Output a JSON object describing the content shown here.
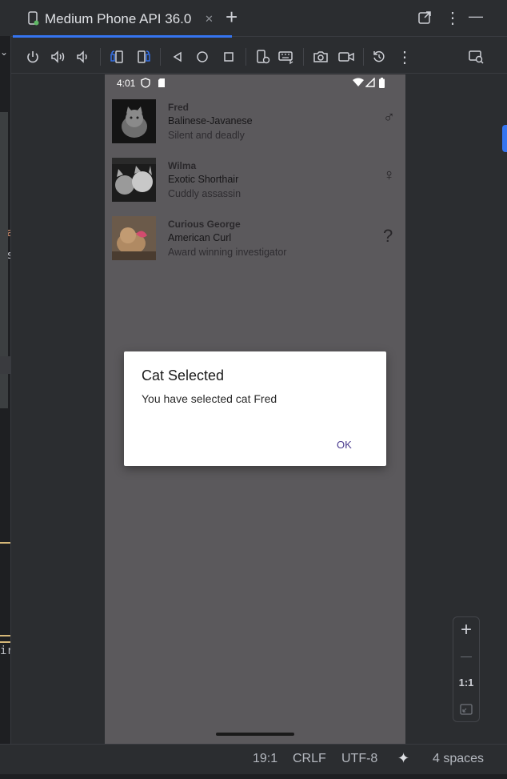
{
  "editor_sliver": {
    "lines": [
      "va",
      "is",
      "s",
      "ir"
    ],
    "line_colors": [
      "#cf8e6d",
      "#bcbec4",
      "#7a7e85",
      "#bcbec4"
    ]
  },
  "tab": {
    "title": "Medium Phone API 36.0",
    "close_glyph": "✕",
    "add_glyph": "+"
  },
  "window_controls": {
    "detach_icon": "external-link-icon",
    "more_glyph": "⋮",
    "minimize_glyph": "—"
  },
  "toolbar": {
    "icons": [
      "power-icon",
      "volume-up-icon",
      "volume-down-icon",
      "rotate-left-icon",
      "rotate-right-icon",
      "back-icon",
      "home-icon",
      "overview-icon",
      "device-settings-icon",
      "keyboard-icon",
      "camera-icon",
      "record-icon",
      "snapshot-icon",
      "more-icon",
      "device-manager-icon"
    ]
  },
  "phone": {
    "time": "4:01",
    "cats": [
      {
        "name": "Fred",
        "breed": "Balinese-Javanese",
        "description": "Silent and deadly",
        "gender": "♂"
      },
      {
        "name": "Wilma",
        "breed": "Exotic Shorthair",
        "description": "Cuddly assassin",
        "gender": "♀"
      },
      {
        "name": "Curious George",
        "breed": "American Curl",
        "description": "Award winning investigator",
        "gender": "?"
      }
    ],
    "dialog": {
      "title": "Cat Selected",
      "message": "You have selected cat Fred",
      "ok_label": "OK"
    }
  },
  "zoom": {
    "plus": "+",
    "minus": "—",
    "ratio": "1:1"
  },
  "status": {
    "position": "19:1",
    "line_ending": "CRLF",
    "encoding": "UTF-8",
    "ai_glyph": "✦",
    "indent": "4 spaces"
  },
  "colors": {
    "accent": "#3574f0",
    "dialog_button": "#4a3b8f",
    "phone_dim": "#5b595c"
  }
}
